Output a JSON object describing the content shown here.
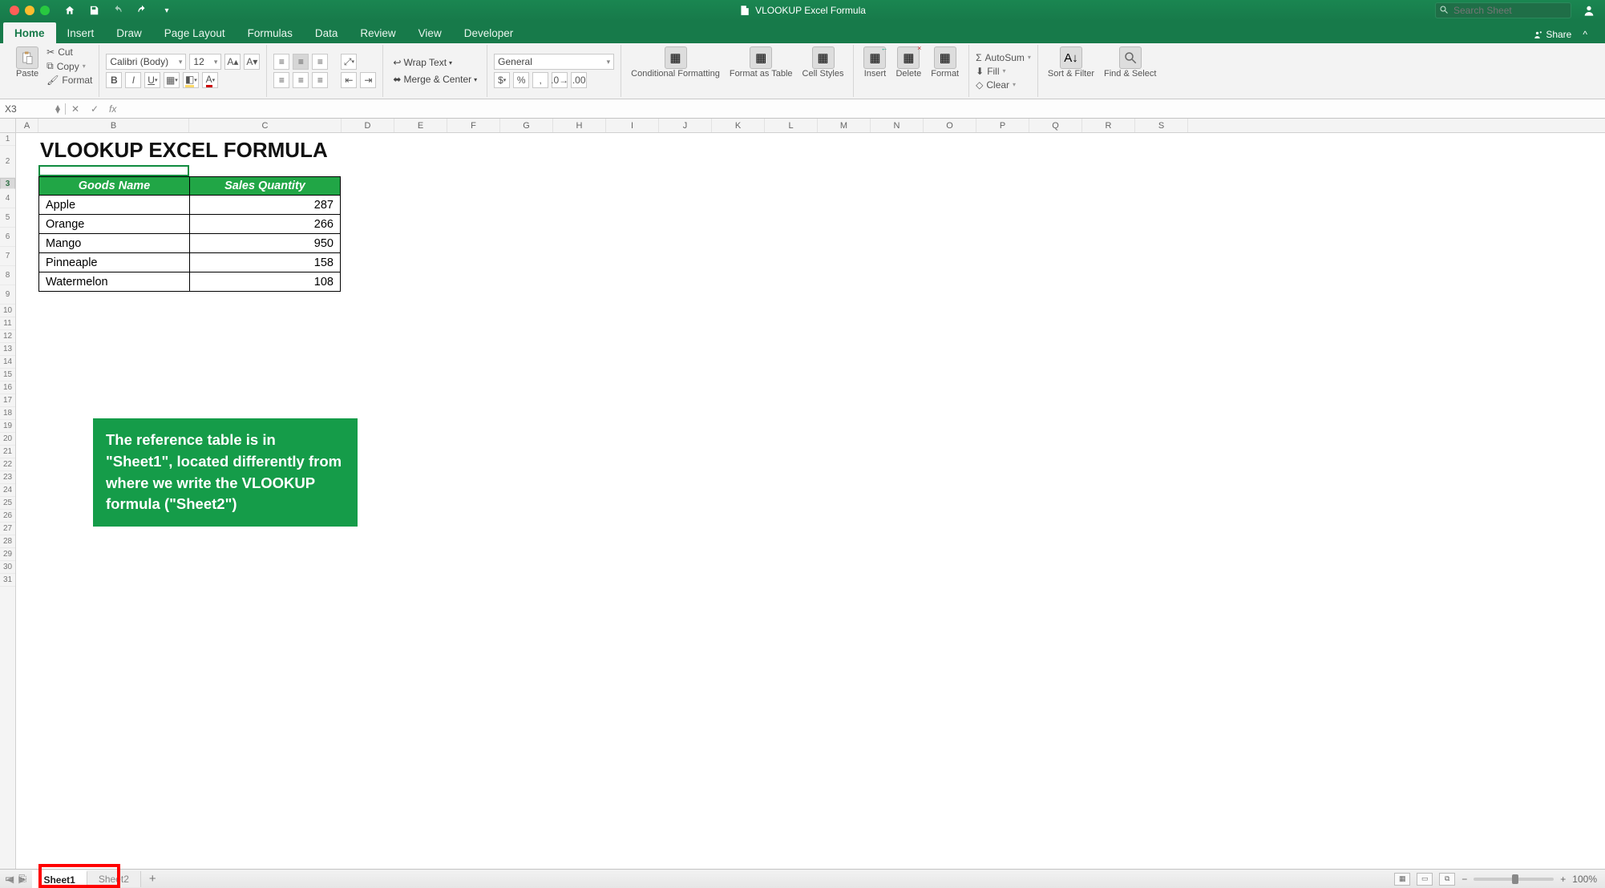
{
  "window": {
    "title": "VLOOKUP Excel Formula",
    "search_placeholder": "Search Sheet"
  },
  "tabs": {
    "items": [
      "Home",
      "Insert",
      "Draw",
      "Page Layout",
      "Formulas",
      "Data",
      "Review",
      "View",
      "Developer"
    ],
    "active": "Home",
    "share": "Share"
  },
  "ribbon": {
    "paste": "Paste",
    "cut": "Cut",
    "copy": "Copy",
    "format_painter": "Format",
    "font_name": "Calibri (Body)",
    "font_size": "12",
    "wrap": "Wrap Text",
    "merge": "Merge & Center",
    "number_format": "General",
    "cond": "Conditional Formatting",
    "as_table": "Format as Table",
    "styles": "Cell Styles",
    "insert": "Insert",
    "delete": "Delete",
    "format": "Format",
    "autosum": "AutoSum",
    "fill": "Fill",
    "clear": "Clear",
    "sort": "Sort & Filter",
    "find": "Find & Select"
  },
  "namebox": {
    "ref": "X3",
    "formula": ""
  },
  "columns": [
    "A",
    "B",
    "C",
    "D",
    "E",
    "F",
    "G",
    "H",
    "I",
    "J",
    "K",
    "L",
    "M",
    "N",
    "O",
    "P",
    "Q",
    "R",
    "S"
  ],
  "sheet": {
    "title": "VLOOKUP EXCEL FORMULA",
    "headers": [
      "Goods Name",
      "Sales Quantity"
    ],
    "rows": [
      {
        "name": "Apple",
        "qty": "287"
      },
      {
        "name": "Orange",
        "qty": "266"
      },
      {
        "name": "Mango",
        "qty": "950"
      },
      {
        "name": "Pinneaple",
        "qty": "158"
      },
      {
        "name": "Watermelon",
        "qty": "108"
      }
    ],
    "callout": "The reference table is in \"Sheet1\", located differently from where we write the VLOOKUP formula (\"Sheet2\")"
  },
  "sheet_tabs": {
    "items": [
      "Sheet1",
      "Sheet2"
    ],
    "active": "Sheet1"
  },
  "status": {
    "zoom": "100%"
  }
}
